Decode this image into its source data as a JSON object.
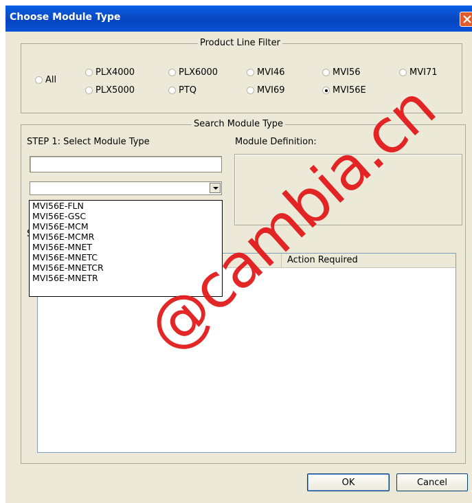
{
  "window": {
    "title": "Choose Module Type"
  },
  "product_filter": {
    "legend": "Product Line Filter",
    "options": [
      {
        "label": "All",
        "checked": false
      },
      {
        "label": "PLX4000",
        "checked": false
      },
      {
        "label": "PLX5000",
        "checked": false
      },
      {
        "label": "PLX6000",
        "checked": false
      },
      {
        "label": "PTQ",
        "checked": false
      },
      {
        "label": "MVI46",
        "checked": false
      },
      {
        "label": "MVI69",
        "checked": false
      },
      {
        "label": "MVI56",
        "checked": false
      },
      {
        "label": "MVI56E",
        "checked": true
      },
      {
        "label": "MVI71",
        "checked": false
      }
    ]
  },
  "search": {
    "legend": "Search Module Type",
    "step1_label": "STEP 1: Select Module Type",
    "definition_label": "Module Definition:",
    "search_value": "",
    "combo_value": "",
    "dropdown_items": [
      "MVI56E-FLN",
      "MVI56E-GSC",
      "MVI56E-MCM",
      "MVI56E-MCMR",
      "MVI56E-MNET",
      "MVI56E-MNETC",
      "MVI56E-MNETCR",
      "MVI56E-MNETR"
    ],
    "hidden_label_fragment": "S",
    "list_columns": [
      "",
      "Action Required"
    ]
  },
  "buttons": {
    "ok": "OK",
    "cancel": "Cancel"
  },
  "watermark": "@cambia.cn",
  "colors": {
    "titlebar": "#0a52d8",
    "dialog_bg": "#ece9d8",
    "watermark": "#e21b1b",
    "close_button": "#e35b2c"
  }
}
